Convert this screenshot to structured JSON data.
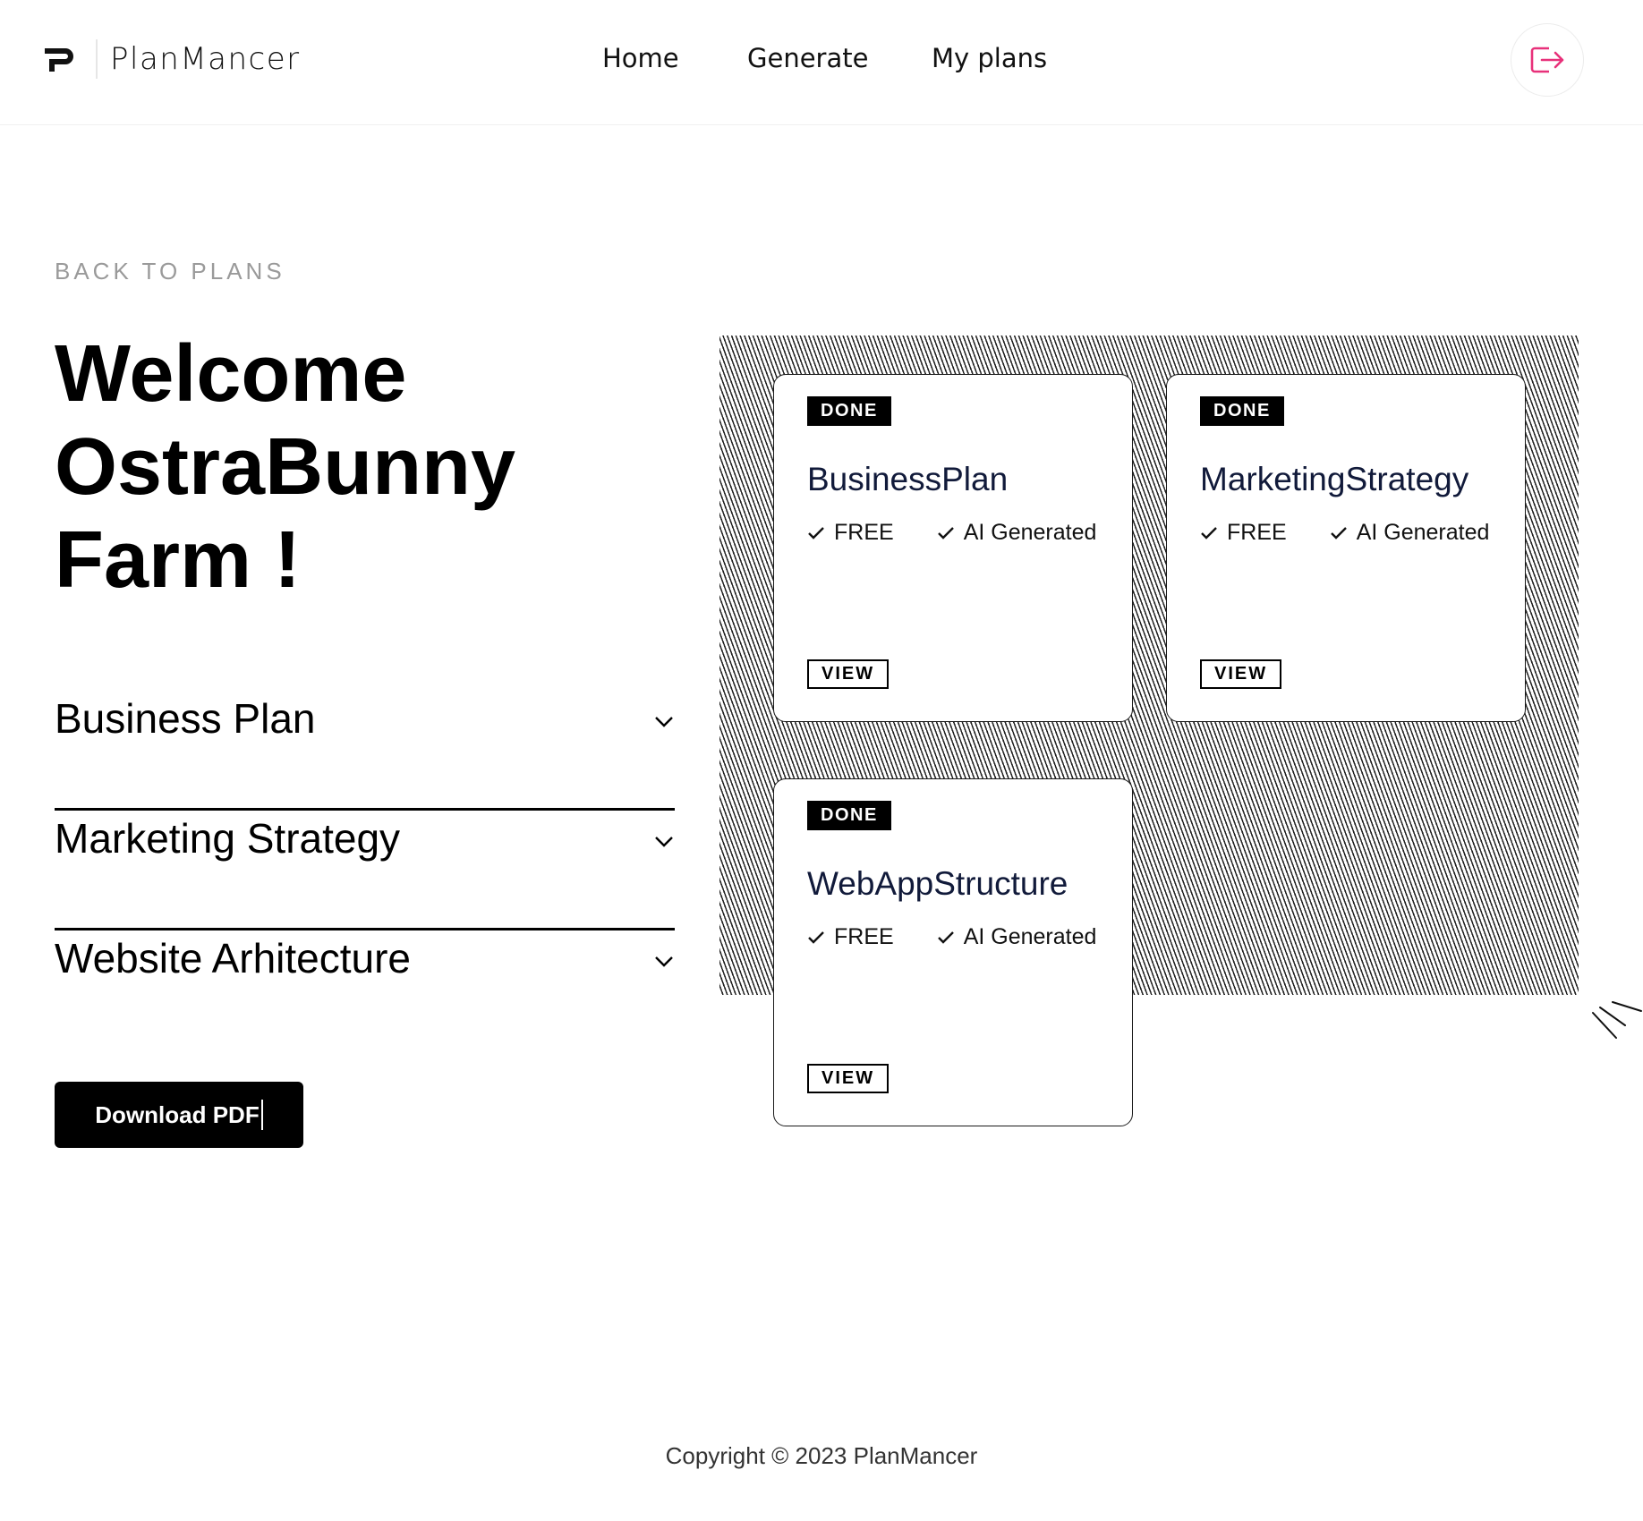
{
  "brand": {
    "name": "PlanMancer"
  },
  "nav": {
    "items": [
      "Home",
      "Generate",
      "My plans"
    ]
  },
  "left": {
    "back_link": "BACK TO PLANS",
    "welcome_lines": [
      "Welcome",
      "OstraBunny",
      "Farm !"
    ],
    "accordion": [
      "Business Plan",
      "Marketing Strategy",
      "Website Arhitecture"
    ],
    "download_label": "Download PDF"
  },
  "cards": [
    {
      "status": "DONE",
      "title": "BusinessPlan",
      "features": [
        "FREE",
        "AI Generated"
      ],
      "action": "VIEW"
    },
    {
      "status": "DONE",
      "title": "MarketingStrategy",
      "features": [
        "FREE",
        "AI Generated"
      ],
      "action": "VIEW"
    },
    {
      "status": "DONE",
      "title": "WebAppStructure",
      "features": [
        "FREE",
        "AI Generated"
      ],
      "action": "VIEW"
    }
  ],
  "footer": {
    "copyright": "Copyright © 2023 PlanMancer"
  },
  "colors": {
    "logout_accent": "#e8317a",
    "card_title": "#111a3a",
    "badge_bg": "#000000"
  }
}
